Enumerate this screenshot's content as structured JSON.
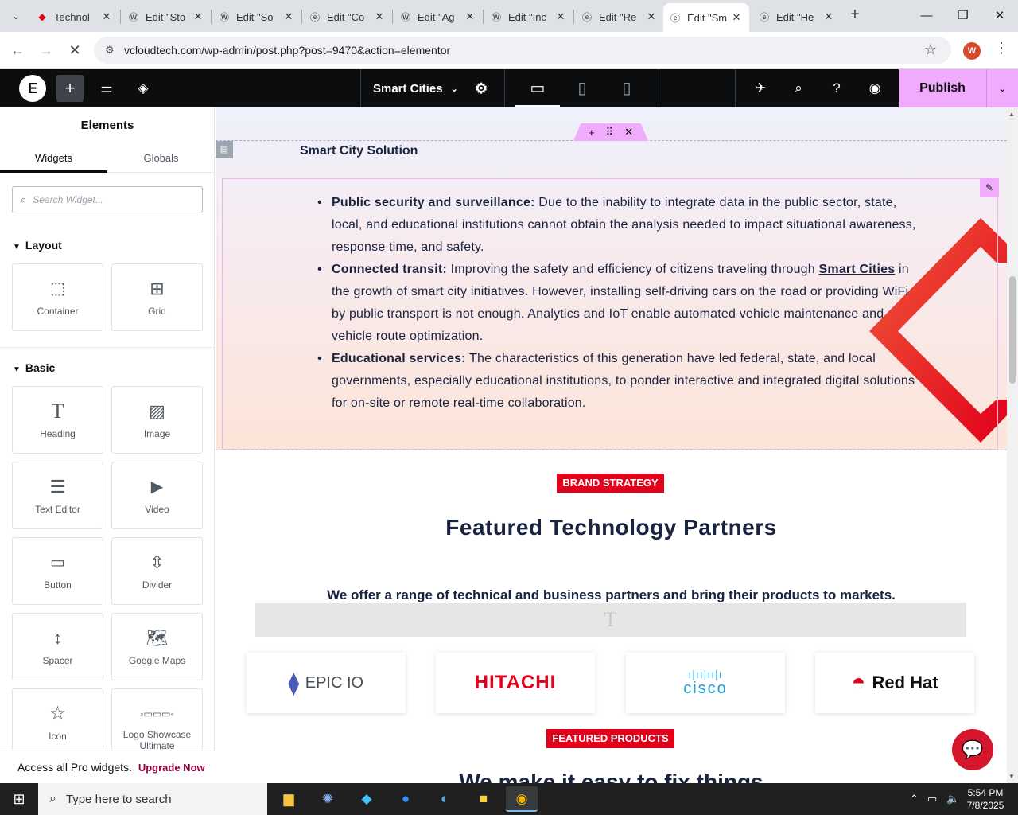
{
  "browser": {
    "tabs": [
      {
        "title": "Technol",
        "icon": "redhat-icon",
        "active": false
      },
      {
        "title": "Edit \"Sto",
        "icon": "wordpress-icon",
        "active": false
      },
      {
        "title": "Edit \"So",
        "icon": "wordpress-icon",
        "active": false
      },
      {
        "title": "Edit \"Co",
        "icon": "elementor-icon",
        "active": false
      },
      {
        "title": "Edit \"Ag",
        "icon": "wordpress-icon",
        "active": false
      },
      {
        "title": "Edit \"Inc",
        "icon": "wordpress-icon",
        "active": false
      },
      {
        "title": "Edit \"Re",
        "icon": "elementor-icon",
        "active": false
      },
      {
        "title": "Edit \"Sm",
        "icon": "elementor-icon",
        "active": true
      },
      {
        "title": "Edit \"He",
        "icon": "elementor-icon",
        "active": false
      }
    ],
    "url": "vcloudtech.com/wp-admin/post.php?post=9470&action=elementor",
    "profile_initial": "W"
  },
  "editor": {
    "document_name": "Smart Cities",
    "publish_label": "Publish"
  },
  "panel": {
    "title": "Elements",
    "tabs": [
      "Widgets",
      "Globals"
    ],
    "search_placeholder": "Search Widget...",
    "layout_label": "Layout",
    "basic_label": "Basic",
    "layout_widgets": [
      "Container",
      "Grid"
    ],
    "basic_widgets": [
      "Heading",
      "Image",
      "Text Editor",
      "Video",
      "Button",
      "Divider",
      "Spacer",
      "Google Maps",
      "Icon",
      "Logo Showcase Ultimate"
    ],
    "footer_text": "Access all Pro widgets.",
    "footer_link": "Upgrade Now"
  },
  "canvas": {
    "section_title": "Smart City Solution",
    "bullets": [
      {
        "bold": "Public security and surveillance:",
        "text": " Due to the inability to integrate data in the public sector, state, local, and educational institutions cannot obtain the analysis needed to impact situational awareness, response time, and safety."
      },
      {
        "bold": "Connected transit:",
        "text_before": " Improving the safety and efficiency of citizens traveling through ",
        "link": "Smart Cities",
        "text_after": " in the growth of smart city initiatives. However, installing self-driving cars on the road or providing WiFi by public transport is not enough. Analytics and IoT enable automated vehicle maintenance and vehicle route optimization."
      },
      {
        "bold": "Educational services:",
        "text": " The characteristics of this generation have led federal, state, and local governments, especially educational institutions, to ponder interactive and integrated digital solutions for on-site or remote real-time collaboration."
      }
    ],
    "badge1": "BRAND STRATEGY",
    "heading": "Featured Technology Partners",
    "subheading": "We offer a range of technical and business partners and bring their products to markets.",
    "partners": [
      "EPIC IO",
      "HITACHI",
      "cisco",
      "Red Hat"
    ],
    "badge2": "FEATURED PRODUCTS",
    "cut_heading": "We make it easy to fix things"
  },
  "taskbar": {
    "search_placeholder": "Type here to search",
    "time": "5:54 PM",
    "date": "7/8/2025"
  },
  "colors": {
    "accent_red": "#e2001a",
    "elementor_pink": "#f0abfc",
    "navy": "#1a2340"
  }
}
